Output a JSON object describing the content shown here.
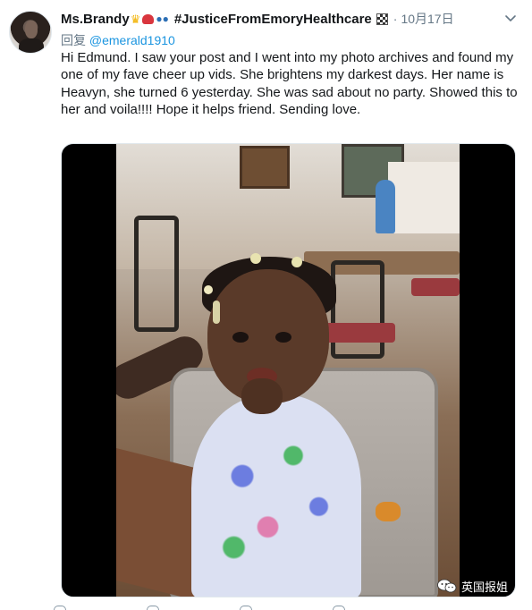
{
  "tweet": {
    "author_name": "Ms.Brandy",
    "author_emojis": [
      "crown-emoji",
      "hat-emoji",
      "sunglasses-emoji"
    ],
    "hashtag": "#JusticeFromEmoryHealthcare",
    "separator": "·",
    "date": "10月17日",
    "reply_prefix": "回复",
    "reply_handle": "@emerald1910",
    "body": "Hi Edmund. I saw your post and I went into my photo archives and found my one of my fave cheer up vids. She brightens my darkest days. Her name is Heavyn, she turned 6 yesterday. She was sad about no party. Showed this to her and voila!!!! Hope it helps friend. Sending love."
  },
  "watermark": {
    "label": "英国报姐"
  },
  "colors": {
    "link": "#1b95e0",
    "secondary": "#657786",
    "text": "#14171a"
  }
}
